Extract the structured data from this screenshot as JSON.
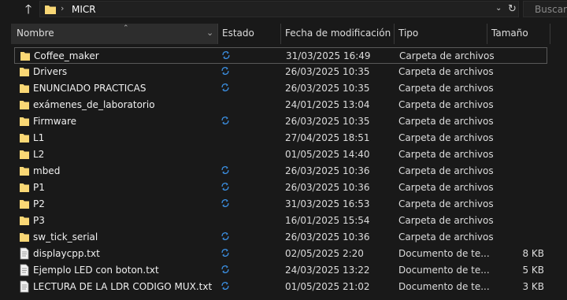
{
  "address": {
    "location": "MICR",
    "separator": "›",
    "search_placeholder": "Buscar e"
  },
  "columns": {
    "name": "Nombre",
    "status": "Estado",
    "modified": "Fecha de modificación",
    "type": "Tipo",
    "size": "Tamaño"
  },
  "colors": {
    "folder": "#f8d775",
    "sync": "#3b8ee0",
    "selection_border": "#595959"
  },
  "files": [
    {
      "name": "Coffee_maker",
      "kind": "folder",
      "sync": true,
      "date": "31/03/2025 16:49",
      "type": "Carpeta de archivos",
      "size": ""
    },
    {
      "name": "Drivers",
      "kind": "folder",
      "sync": true,
      "date": "26/03/2025 10:35",
      "type": "Carpeta de archivos",
      "size": ""
    },
    {
      "name": "ENUNCIADO PRACTICAS",
      "kind": "folder",
      "sync": true,
      "date": "26/03/2025 10:35",
      "type": "Carpeta de archivos",
      "size": ""
    },
    {
      "name": "exámenes_de_laboratorio",
      "kind": "folder",
      "sync": false,
      "date": "24/01/2025 13:04",
      "type": "Carpeta de archivos",
      "size": ""
    },
    {
      "name": "Firmware",
      "kind": "folder",
      "sync": true,
      "date": "26/03/2025 10:35",
      "type": "Carpeta de archivos",
      "size": ""
    },
    {
      "name": "L1",
      "kind": "folder",
      "sync": false,
      "date": "27/04/2025 18:51",
      "type": "Carpeta de archivos",
      "size": ""
    },
    {
      "name": "L2",
      "kind": "folder",
      "sync": false,
      "date": "01/05/2025 14:40",
      "type": "Carpeta de archivos",
      "size": ""
    },
    {
      "name": "mbed",
      "kind": "folder",
      "sync": true,
      "date": "26/03/2025 10:36",
      "type": "Carpeta de archivos",
      "size": ""
    },
    {
      "name": "P1",
      "kind": "folder",
      "sync": true,
      "date": "26/03/2025 10:36",
      "type": "Carpeta de archivos",
      "size": ""
    },
    {
      "name": "P2",
      "kind": "folder",
      "sync": true,
      "date": "31/03/2025 16:53",
      "type": "Carpeta de archivos",
      "size": ""
    },
    {
      "name": "P3",
      "kind": "folder",
      "sync": false,
      "date": "16/01/2025 15:54",
      "type": "Carpeta de archivos",
      "size": ""
    },
    {
      "name": "sw_tick_serial",
      "kind": "folder",
      "sync": true,
      "date": "26/03/2025 10:36",
      "type": "Carpeta de archivos",
      "size": ""
    },
    {
      "name": "displaycpp.txt",
      "kind": "file",
      "sync": true,
      "date": "02/05/2025 2:20",
      "type": "Documento de te...",
      "size": "8 KB"
    },
    {
      "name": "Ejemplo LED con boton.txt",
      "kind": "file",
      "sync": true,
      "date": "24/03/2025 13:22",
      "type": "Documento de te...",
      "size": "5 KB"
    },
    {
      "name": "LECTURA DE LA LDR CODIGO MUX.txt",
      "kind": "file",
      "sync": true,
      "date": "01/05/2025 21:02",
      "type": "Documento de te...",
      "size": "3 KB"
    }
  ]
}
